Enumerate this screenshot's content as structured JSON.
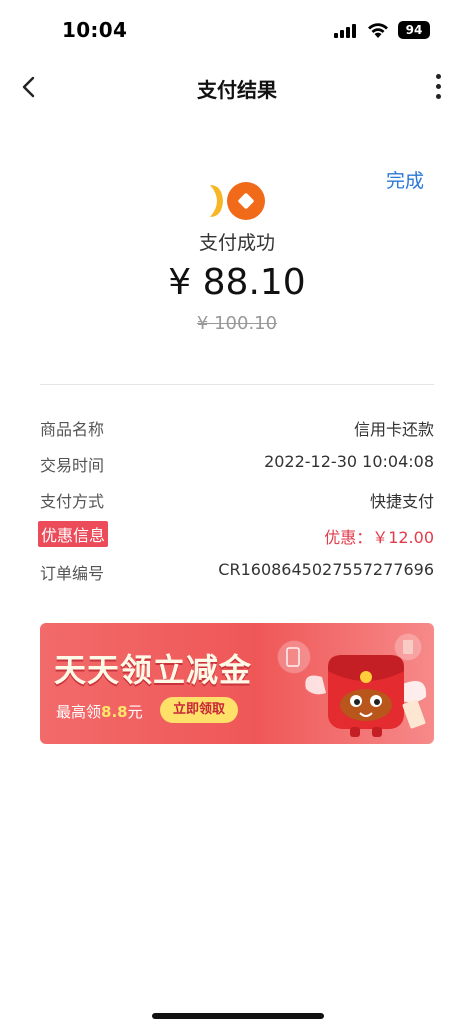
{
  "status_bar": {
    "time": "10:04",
    "battery": "94"
  },
  "nav": {
    "title": "支付结果",
    "back_icon": "chevron-left-icon",
    "more_icon": "more-vertical-icon"
  },
  "header": {
    "done_label": "完成",
    "result_text": "支付成功",
    "amount": "¥ 88.10",
    "original_amount": "¥ 100.10"
  },
  "details": [
    {
      "label": "商品名称",
      "value": "信用卡还款"
    },
    {
      "label": "交易时间",
      "value": "2022-12-30 10:04:08"
    },
    {
      "label": "支付方式",
      "value": "快捷支付"
    },
    {
      "label": "优惠信息",
      "value": "优惠：￥12.00"
    },
    {
      "label": "订单编号",
      "value": "CR1608645027557277696"
    }
  ],
  "banner": {
    "title": "天天领立减金",
    "subtitle_prefix": "最高领",
    "subtitle_amount": "8.8",
    "subtitle_suffix": "元",
    "button_label": "立即领取"
  },
  "colors": {
    "accent_blue": "#2c78d8",
    "discount_red": "#e23c4c",
    "banner_red": "#ef5757",
    "logo_orange": "#f06a1a",
    "logo_yellow": "#f7b626"
  }
}
